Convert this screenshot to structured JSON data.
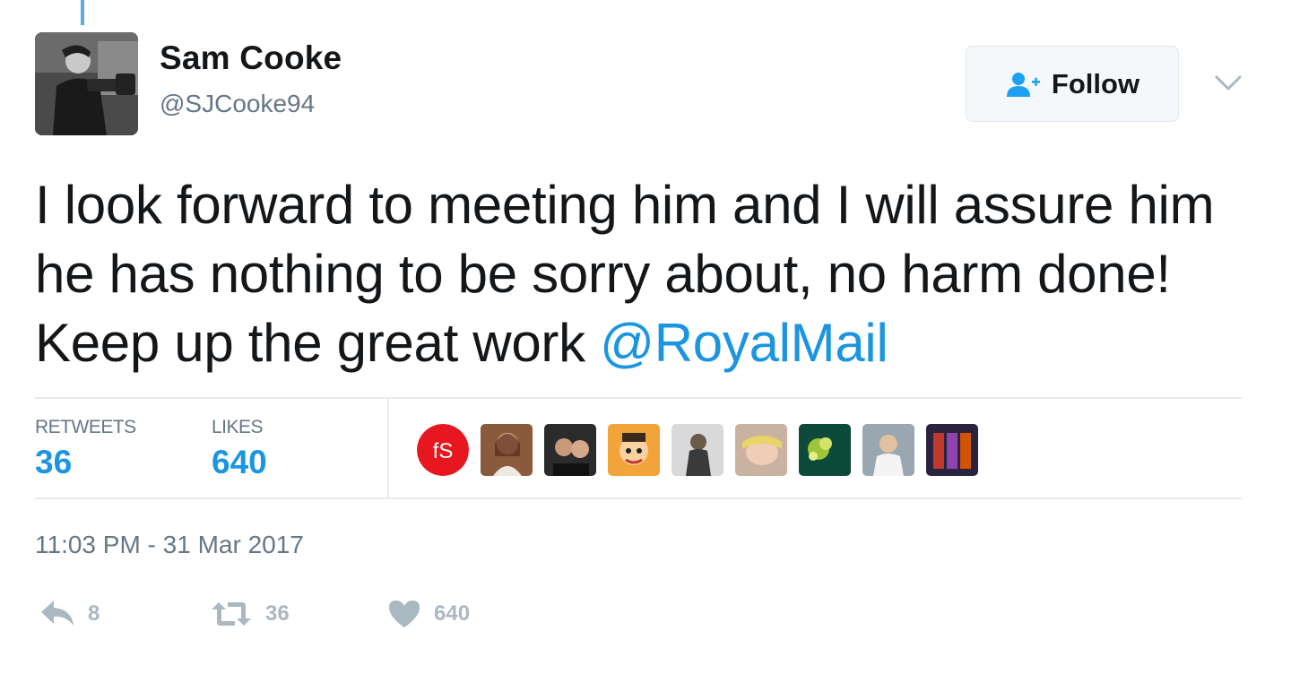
{
  "user": {
    "display_name": "Sam Cooke",
    "handle": "@SJCooke94"
  },
  "follow_button": {
    "label": "Follow"
  },
  "tweet": {
    "text": "I look forward to meeting him and I will assure him he has nothing to be sorry about, no harm done! Keep up the great work ",
    "mention": "@RoyalMail"
  },
  "stats": {
    "retweets_label": "RETWEETS",
    "retweets_value": "36",
    "likes_label": "LIKES",
    "likes_value": "640"
  },
  "timestamp": "11:03 PM - 31 Mar 2017",
  "actions": {
    "reply_count": "8",
    "retweet_count": "36",
    "like_count": "640"
  },
  "colors": {
    "link": "#1b95e0",
    "muted": "#657786",
    "action_gray": "#aab8c2",
    "thread_line": "#5ea9dd"
  }
}
